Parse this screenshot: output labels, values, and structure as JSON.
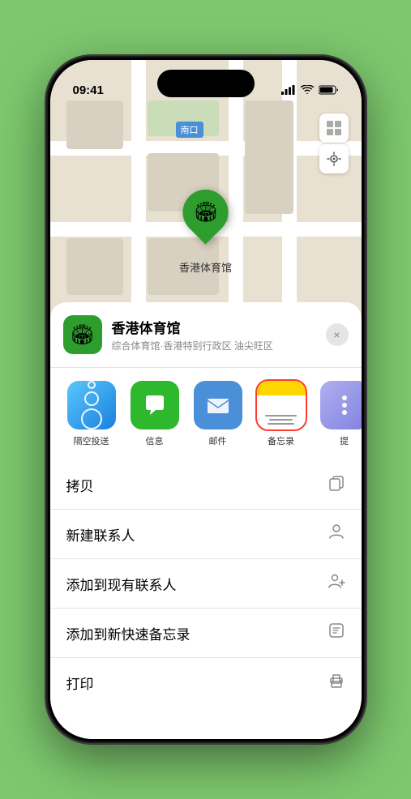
{
  "status": {
    "time": "09:41",
    "signal": "●●●●",
    "wifi": "wifi",
    "battery": "battery"
  },
  "map": {
    "label": "南口",
    "pin_label": "香港体育馆"
  },
  "location": {
    "name": "香港体育馆",
    "subtitle": "综合体育馆·香港特别行政区 油尖旺区"
  },
  "share_items": [
    {
      "id": "airdrop",
      "label": "隔空投送"
    },
    {
      "id": "message",
      "label": "信息"
    },
    {
      "id": "mail",
      "label": "邮件"
    },
    {
      "id": "notes",
      "label": "备忘录"
    },
    {
      "id": "more",
      "label": "提"
    }
  ],
  "actions": [
    {
      "label": "拷贝",
      "icon": "copy"
    },
    {
      "label": "新建联系人",
      "icon": "person"
    },
    {
      "label": "添加到现有联系人",
      "icon": "person-add"
    },
    {
      "label": "添加到新快速备忘录",
      "icon": "note"
    },
    {
      "label": "打印",
      "icon": "print"
    }
  ],
  "close_label": "×"
}
